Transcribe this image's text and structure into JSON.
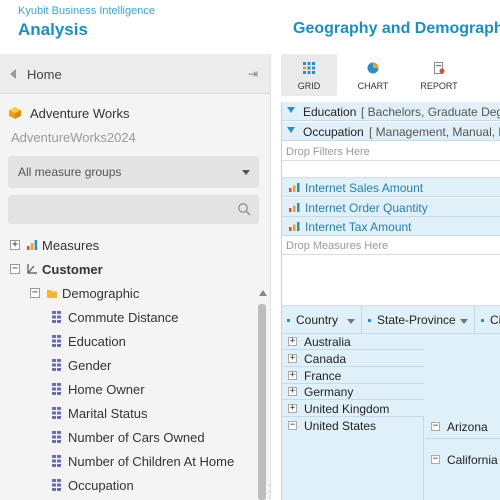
{
  "header": {
    "brand": "Kyubit Business Intelligence",
    "app_title": "Analysis",
    "report_title": "Geography and Demographic"
  },
  "sidebar": {
    "home_label": "Home",
    "cube_name": "Adventure Works",
    "database_name": "AdventureWorks2024",
    "measure_group_select": "All measure groups",
    "search_placeholder": "",
    "tree": [
      {
        "label": "Measures",
        "expander": "+",
        "icon": "bar-chart-icon"
      },
      {
        "label": "Customer",
        "expander": "−",
        "icon": "dimension-icon"
      },
      {
        "label": "Demographic",
        "expander": "−",
        "icon": "folder-icon"
      },
      {
        "label": "Commute Distance",
        "icon": "attribute-icon"
      },
      {
        "label": "Education",
        "icon": "attribute-icon"
      },
      {
        "label": "Gender",
        "icon": "attribute-icon"
      },
      {
        "label": "Home Owner",
        "icon": "attribute-icon"
      },
      {
        "label": "Marital Status",
        "icon": "attribute-icon"
      },
      {
        "label": "Number of Cars Owned",
        "icon": "attribute-icon"
      },
      {
        "label": "Number of Children At Home",
        "icon": "attribute-icon"
      },
      {
        "label": "Occupation",
        "icon": "attribute-icon"
      }
    ]
  },
  "toolbar": {
    "grid_label": "GRID",
    "chart_label": "CHART",
    "report_label": "REPORT"
  },
  "pivot": {
    "filters": [
      {
        "name": "Education",
        "value": "[ Bachelors, Graduate Degree ]"
      },
      {
        "name": "Occupation",
        "value": "[ Management, Manual, Professional ]"
      }
    ],
    "drop_filters": "Drop Filters Here",
    "measures": [
      "Internet Sales Amount",
      "Internet Order Quantity",
      "Internet Tax Amount"
    ],
    "drop_measures": "Drop Measures Here",
    "row_headers": [
      "Country",
      "State-Province",
      "City"
    ],
    "countries": [
      "Australia",
      "Canada",
      "France",
      "Germany",
      "United Kingdom"
    ],
    "expanded_country": "United States",
    "states": [
      "Arizona",
      "California"
    ]
  },
  "colors": {
    "accent": "#1a8fc0",
    "pivot_bg": "#dff0f8",
    "measure_text": "#2a7fa8"
  }
}
